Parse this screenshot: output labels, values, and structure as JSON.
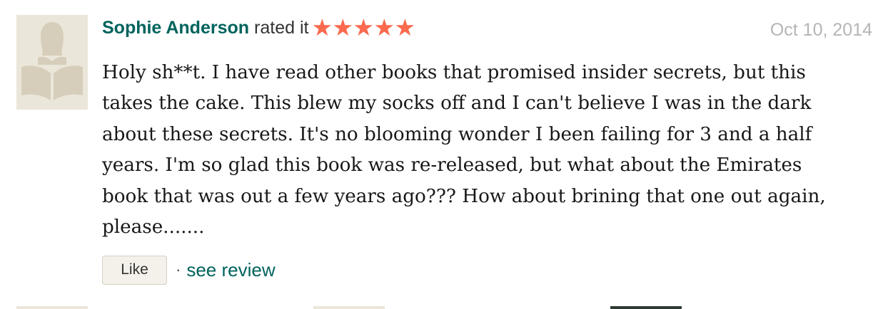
{
  "review": {
    "user_name": "Sophie Anderson",
    "rated_text": "rated it",
    "rating": 5,
    "rating_max": 5,
    "star_glyph": "★",
    "date": "Oct 10, 2014",
    "lines": [
      "Holy sh**t. I have read other books that promised insider secrets, but this",
      "takes the cake. This blew my socks off and I can't believe I was in the dark",
      "about these secrets. It's no blooming wonder I been failing for 3 and a half",
      "years. I'm so glad this book was re-released, but what about the Emirates",
      "book that was out a few years ago??? How about brining that one out again,",
      "please......."
    ],
    "like_label": "Like",
    "separator": "·",
    "see_review_label": "see review"
  },
  "icons": {
    "avatar": "default-reader-avatar-icon",
    "star": "star-icon"
  },
  "colors": {
    "link": "#00635d",
    "star": "#fb6a4f",
    "date": "#b5b5b5",
    "avatar_bg": "#ebe6da",
    "avatar_figure": "#d6ceba",
    "button_bg": "#f4f1ea"
  }
}
